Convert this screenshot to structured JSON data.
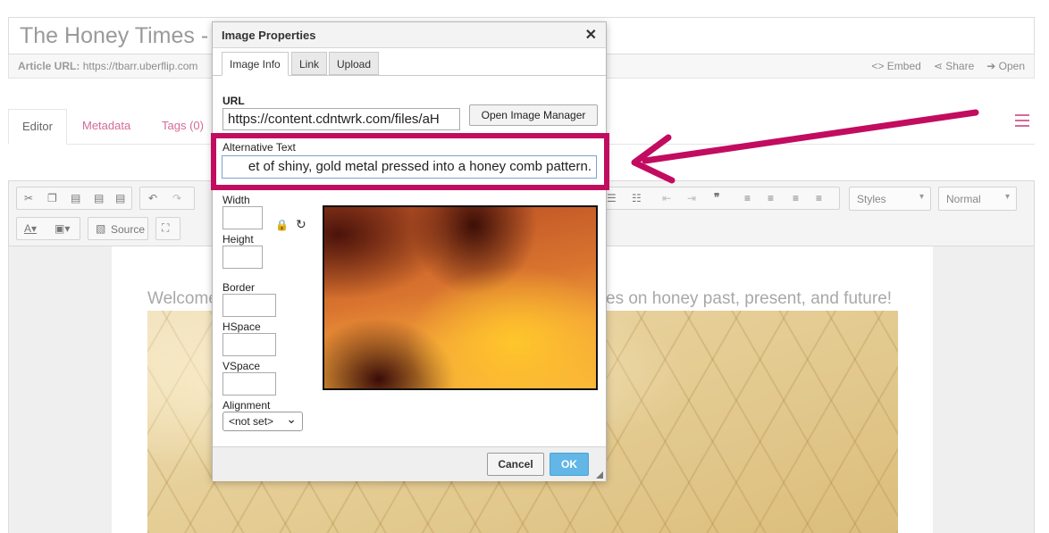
{
  "page": {
    "title": "The Honey Times -",
    "article_url_label": "Article URL:",
    "article_url": "https://tbarr.uberflip.com",
    "actions": [
      "<> Embed",
      "Share",
      "Open"
    ]
  },
  "editor_tabs": [
    "Editor",
    "Metadata",
    "Tags (0)"
  ],
  "toolbar": {
    "source_label": "Source",
    "styles_label": "Styles",
    "format_label": "Normal"
  },
  "canvas": {
    "welcome_start": "Welcome",
    "welcome_end": "es on honey past, present, and future!"
  },
  "dialog": {
    "title": "Image Properties",
    "tabs": [
      "Image Info",
      "Link",
      "Upload"
    ],
    "url_label": "URL",
    "url_value": "https://content.cdntwrk.com/files/aH",
    "open_manager_label": "Open Image Manager",
    "alt_label": "Alternative Text",
    "alt_value": "et of shiny, gold metal pressed into a honey comb pattern.",
    "width_label": "Width",
    "height_label": "Height",
    "border_label": "Border",
    "hspace_label": "HSpace",
    "vspace_label": "VSpace",
    "alignment_label": "Alignment",
    "alignment_value": "<not set>",
    "cancel_label": "Cancel",
    "ok_label": "OK"
  },
  "colors": {
    "accent_pink": "#d56a97",
    "highlight": "#c20c5f",
    "ok_blue": "#62b7e6"
  }
}
